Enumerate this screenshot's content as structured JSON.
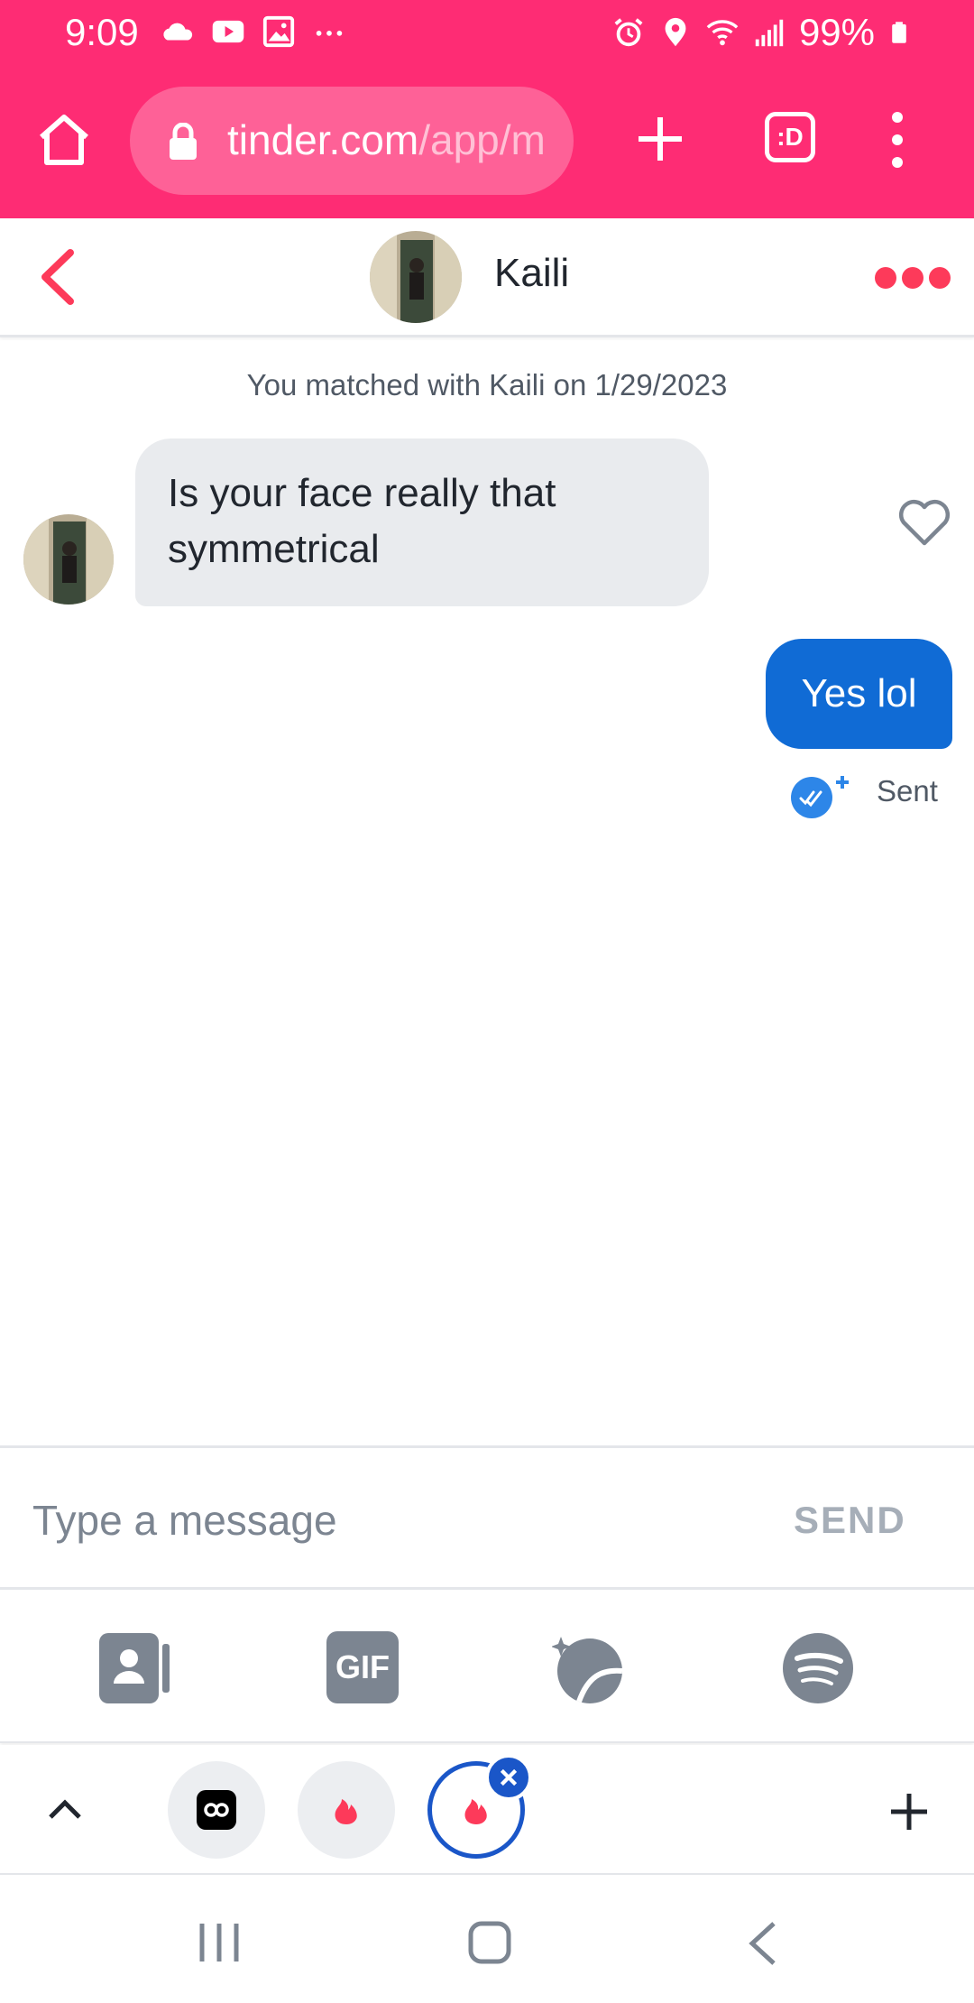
{
  "status_bar": {
    "time": "9:09",
    "battery_text": "99%",
    "left_icons": [
      "cloud-icon",
      "youtube-icon",
      "image-icon",
      "more-dots-icon"
    ],
    "right_icons": [
      "alarm-icon",
      "location-icon",
      "wifi-icon",
      "signal-icon",
      "battery-icon"
    ]
  },
  "browser": {
    "url_host": "tinder.com",
    "url_path": "/app/m",
    "tabs_button_label": ":D"
  },
  "chat": {
    "contact_name": "Kaili",
    "match_info": "You matched with Kaili on 1/29/2023",
    "messages": [
      {
        "direction": "incoming",
        "text": "Is your face really that symmetrical"
      },
      {
        "direction": "outgoing",
        "text": "Yes lol",
        "status": "Sent"
      }
    ]
  },
  "composer": {
    "placeholder": "Type a message",
    "send_label": "SEND"
  },
  "attachments": {
    "gif_label": "GIF",
    "items": [
      "contact-card-icon",
      "gif-icon",
      "sticker-icon",
      "spotify-icon"
    ]
  },
  "colors": {
    "browser_bar": "#fe2c74",
    "accent_red": "#fd3a5a",
    "outgoing_bubble": "#106bd5",
    "incoming_bubble": "#e9ebee",
    "tab_active": "#1a56c8"
  }
}
